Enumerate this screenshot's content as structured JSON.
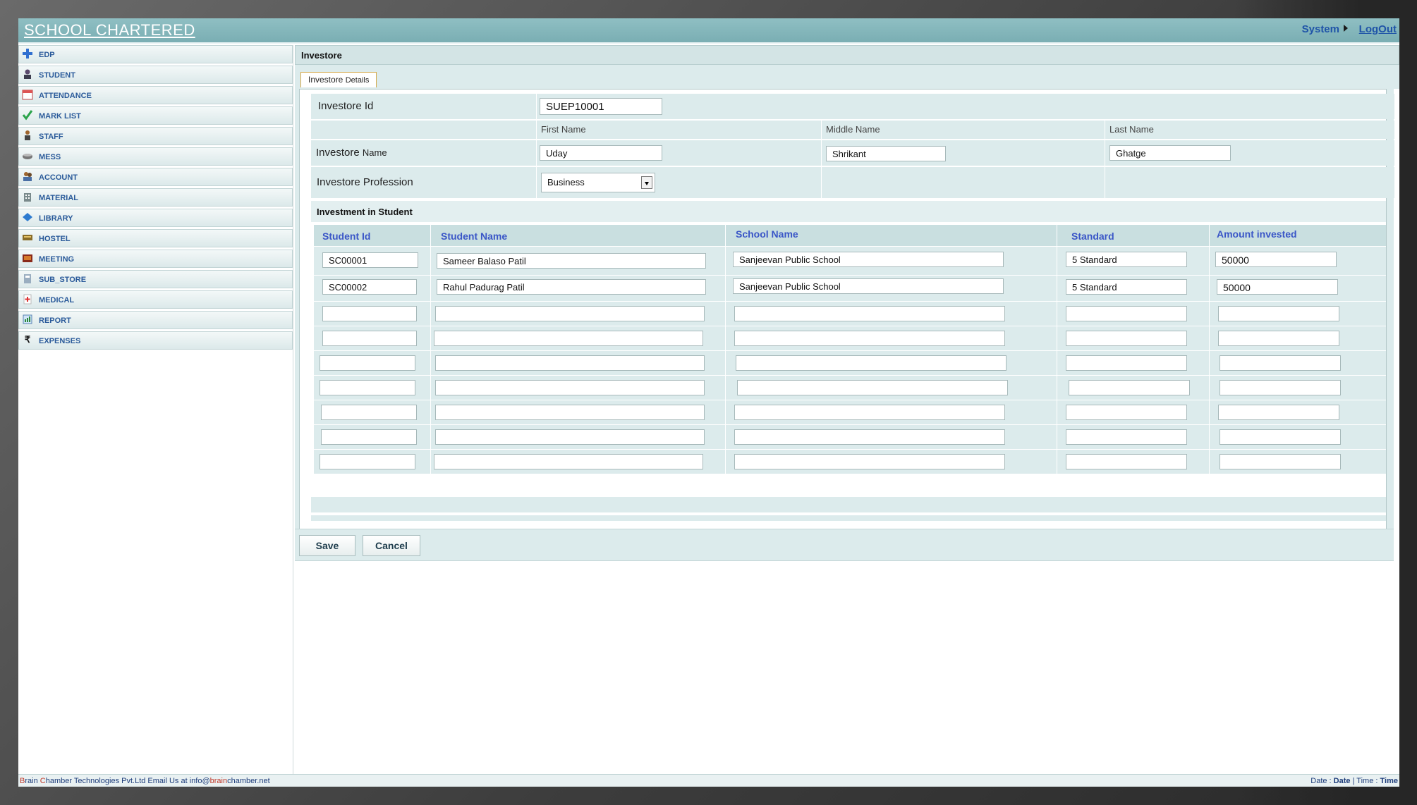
{
  "app": {
    "title": "SCHOOL CHARTERED",
    "system_label": "System",
    "logout_label": "LogOut"
  },
  "sidebar": {
    "items": [
      {
        "label": "EDP",
        "icon": "plus-icon"
      },
      {
        "label": "STUDENT",
        "icon": "student-icon"
      },
      {
        "label": "ATTENDANCE",
        "icon": "calendar-icon"
      },
      {
        "label": "MARK LIST",
        "icon": "checkmark-icon"
      },
      {
        "label": "STAFF",
        "icon": "person-icon"
      },
      {
        "label": "MESS",
        "icon": "food-bowl-icon"
      },
      {
        "label": "ACCOUNT",
        "icon": "users-icon"
      },
      {
        "label": "MATERIAL",
        "icon": "building-icon"
      },
      {
        "label": "LIBRARY",
        "icon": "book-icon"
      },
      {
        "label": "HOSTEL",
        "icon": "hostel-icon"
      },
      {
        "label": "MEETING",
        "icon": "meeting-icon"
      },
      {
        "label": "SUB_STORE",
        "icon": "store-icon"
      },
      {
        "label": "MEDICAL",
        "icon": "medical-icon"
      },
      {
        "label": "REPORT",
        "icon": "report-icon"
      },
      {
        "label": "EXPENSES",
        "icon": "rupee-icon"
      }
    ]
  },
  "page": {
    "section_title": "Investore",
    "tab_label_main": "Investore",
    "tab_label_small": "Details"
  },
  "form": {
    "id_label": "Investore  Id",
    "id_value": "SUEP10001",
    "first_name_header": "First Name",
    "middle_name_header": "Middle Name",
    "last_name_header": "Last Name",
    "name_label_main": "Investore",
    "name_label_small": "Name",
    "first_name": "Uday",
    "middle_name": "Shrikant",
    "last_name": "Ghatge",
    "profession_label": "Investore Profession",
    "profession_value": "Business"
  },
  "investment": {
    "title": "Investment in Student",
    "headers": [
      "Student Id",
      "Student Name",
      "School Name",
      "Standard",
      "Amount invested"
    ],
    "rows": [
      [
        "SC00001",
        "Sameer  Balaso Patil",
        "Sanjeevan Public School",
        "5 Standard",
        "50000"
      ],
      [
        "SC00002",
        "Rahul Padurag Patil",
        "Sanjeevan Public School",
        "5 Standard",
        "50000"
      ],
      [
        "",
        "",
        "",
        "",
        ""
      ],
      [
        "",
        "",
        "",
        "",
        ""
      ],
      [
        "",
        "",
        "",
        "",
        ""
      ],
      [
        "",
        "",
        "",
        "",
        ""
      ],
      [
        "",
        "",
        "",
        "",
        ""
      ],
      [
        "",
        "",
        "",
        "",
        ""
      ],
      [
        "",
        "",
        "",
        "",
        ""
      ]
    ]
  },
  "buttons": {
    "save": "Save",
    "cancel": "Cancel"
  },
  "footer": {
    "company_b": "B",
    "company_rain": "rain ",
    "company_c": "C",
    "company_rest": "hamber Technologies Pvt.Ltd   Email Us at info@",
    "email_brain": "brain",
    "email_rest": "chamber.net",
    "date_label": "Date : ",
    "date_value": "Date",
    "sep": " | ",
    "time_label": "Time : ",
    "time_value": "Time"
  }
}
